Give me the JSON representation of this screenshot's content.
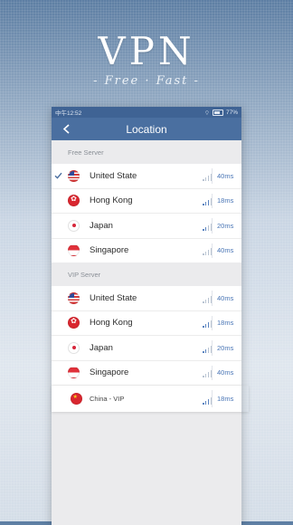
{
  "hero": {
    "title": "VPN",
    "subtitle": "- Free · Fast -"
  },
  "status_bar": {
    "time": "中午12:52",
    "battery": "77%"
  },
  "app_bar": {
    "title": "Location"
  },
  "colors": {
    "accent": "#4a6fa0",
    "ping": "#4a76b6",
    "status_bar": "#3f6394"
  },
  "free_section": {
    "header": "Free Server",
    "items": [
      {
        "name": "United State",
        "ping": "40ms",
        "flag": "us-flag-icon",
        "selected": true
      },
      {
        "name": "Hong Kong",
        "ping": "18ms",
        "flag": "hk-flag-icon"
      },
      {
        "name": "Japan",
        "ping": "20ms",
        "flag": "jp-flag-icon"
      },
      {
        "name": "Singapore",
        "ping": "40ms",
        "flag": "sg-flag-icon"
      }
    ]
  },
  "vip_section": {
    "header": "VIP Server",
    "items": [
      {
        "name": "United State",
        "ping": "40ms",
        "flag": "us-flag-icon"
      },
      {
        "name": "Hong Kong",
        "ping": "18ms",
        "flag": "hk-flag-icon"
      },
      {
        "name": "Japan",
        "ping": "20ms",
        "flag": "jp-flag-icon"
      },
      {
        "name": "Singapore",
        "ping": "40ms",
        "flag": "sg-flag-icon"
      },
      {
        "name": "China - VIP",
        "ping": "18ms",
        "flag": "cn-flag-icon"
      }
    ]
  }
}
